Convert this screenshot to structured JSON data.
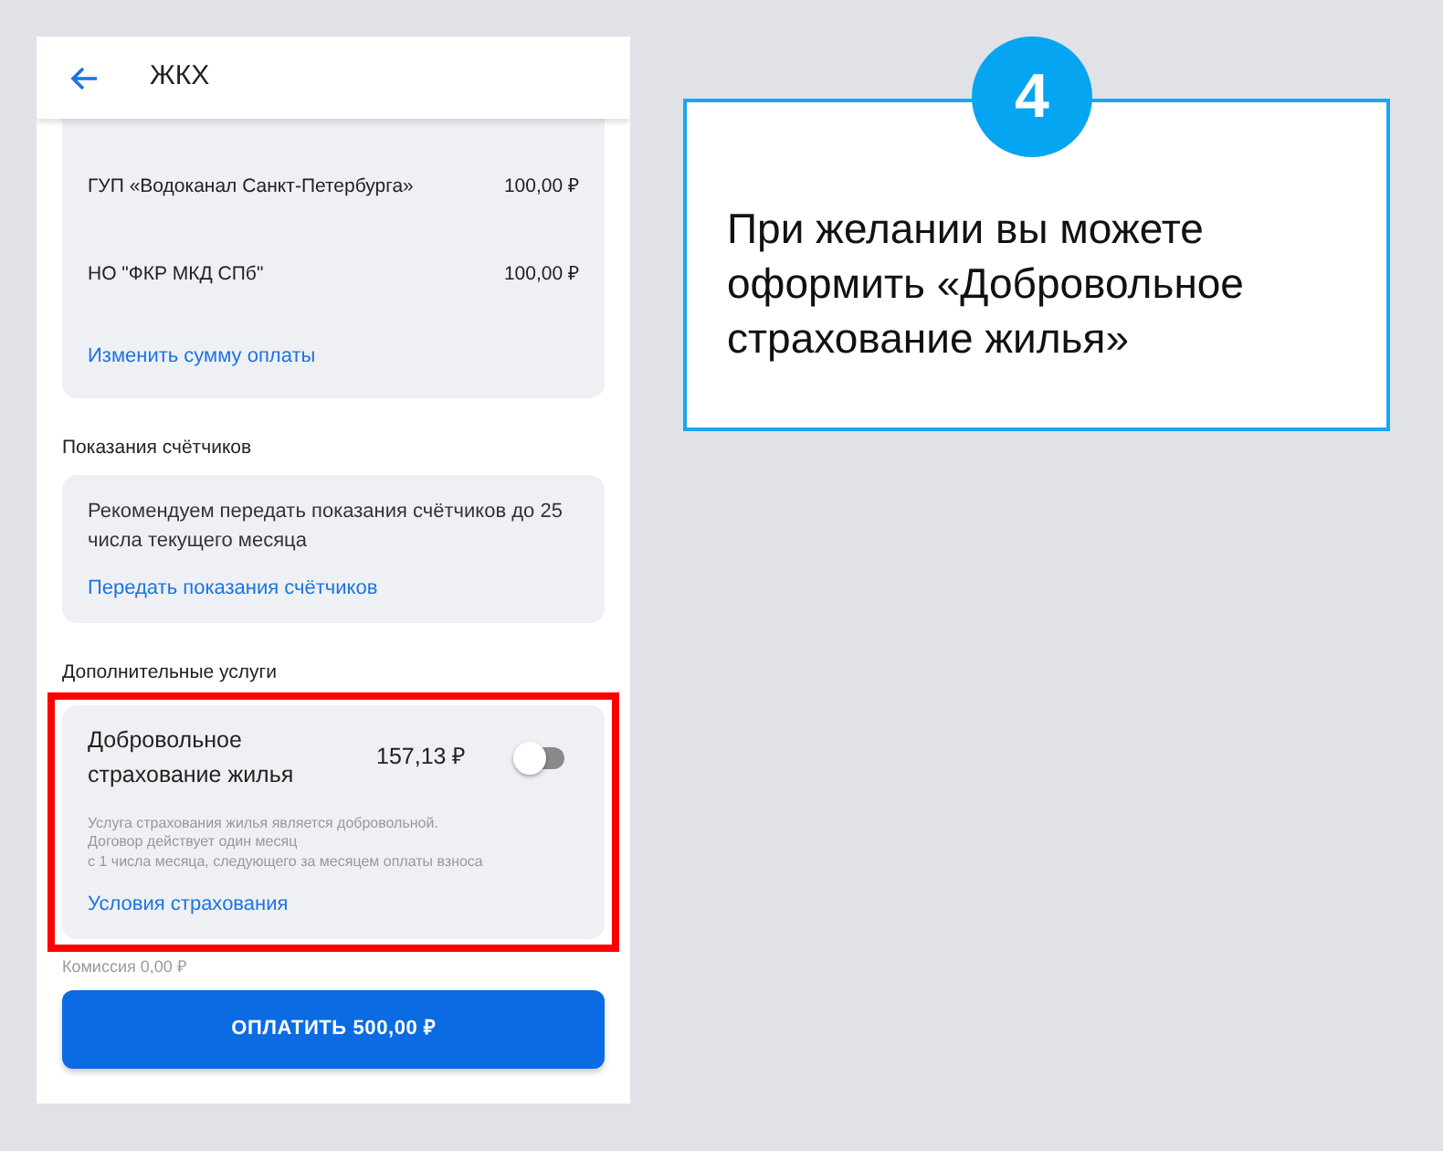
{
  "header": {
    "title": "ЖКХ"
  },
  "payments": [
    {
      "name": "ГУП «Водоканал Санкт-Петербурга»",
      "amount": "100,00 ₽"
    },
    {
      "name": "НО \"ФКР МКД СПб\"",
      "amount": "100,00 ₽"
    }
  ],
  "payments_link": "Изменить сумму оплаты",
  "meters": {
    "heading": "Показания счётчиков",
    "text": "Рекомендуем передать показания счётчиков до 25 числа текущего месяца",
    "link": "Передать показания счётчиков"
  },
  "extras": {
    "heading": "Дополнительные услуги",
    "service": {
      "name": "Добровольное страхование жилья",
      "price": "157,13 ₽",
      "on": false,
      "highlighted": true,
      "note": [
        "Услуга страхования жилья является добровольной.",
        "Договор действует один месяц",
        "с 1 числа месяца, следующего за месяцем оплаты взноса"
      ],
      "link": "Условия страхования"
    }
  },
  "commission": "Комиссия 0,00 ₽",
  "pay_button": "ОПЛАТИТЬ 500,00 ₽",
  "callout": {
    "step": "4",
    "text": "При желании вы можете оформить «Добровольное страхование жилья»"
  }
}
